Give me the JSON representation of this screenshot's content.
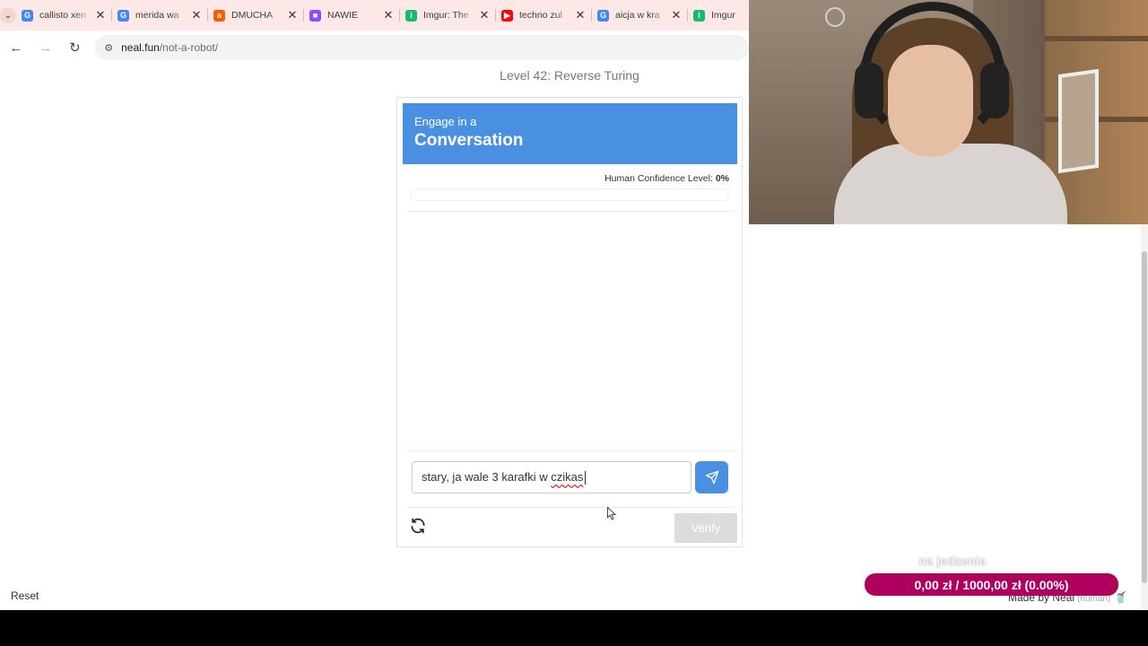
{
  "browser": {
    "tabs": [
      {
        "title": "callisto xen",
        "favicon": "google-icon",
        "color": "#4285f4",
        "glyph": "G"
      },
      {
        "title": "merida wa",
        "favicon": "google-icon",
        "color": "#4285f4",
        "glyph": "G"
      },
      {
        "title": "DMUCHA",
        "favicon": "allegro-icon",
        "color": "#ff5a00",
        "glyph": "a"
      },
      {
        "title": "NAWIE",
        "favicon": "twitch-icon",
        "color": "#9146ff",
        "glyph": "■"
      },
      {
        "title": "Imgur: The",
        "favicon": "imgur-icon",
        "color": "#1bb76e",
        "glyph": "i"
      },
      {
        "title": "techno zul",
        "favicon": "youtube-icon",
        "color": "#ff0000",
        "glyph": "▶"
      },
      {
        "title": "aicja w kra",
        "favicon": "google-icon",
        "color": "#4285f4",
        "glyph": "G"
      },
      {
        "title": "Imgur",
        "favicon": "imgur-icon",
        "color": "#1bb76e",
        "glyph": "i"
      }
    ],
    "url_host": "neal.fun",
    "url_path": "/not-a-robot/"
  },
  "page": {
    "level_title": "Level 42: Reverse Turing",
    "card": {
      "header_small": "Engage in a",
      "header_big": "Conversation",
      "confidence_label": "Human Confidence Level: ",
      "confidence_value": "0%",
      "confidence_fraction": 0,
      "input_text_plain": "stary, ja wale 3 karafki w ",
      "input_text_misspelled": "czikas",
      "verify_label": "Verify"
    },
    "reset_label": "Reset",
    "made_by": "Made by Neal",
    "made_by_tag": "(human)"
  },
  "overlay": {
    "goal_label": "na jedzenie",
    "goal_text": "0,00 zł  /  1000,00 zł (0.00%)"
  },
  "colors": {
    "accent": "#4a90e2",
    "goal": "#b0005e",
    "tab_bar": "#fce8e6"
  }
}
